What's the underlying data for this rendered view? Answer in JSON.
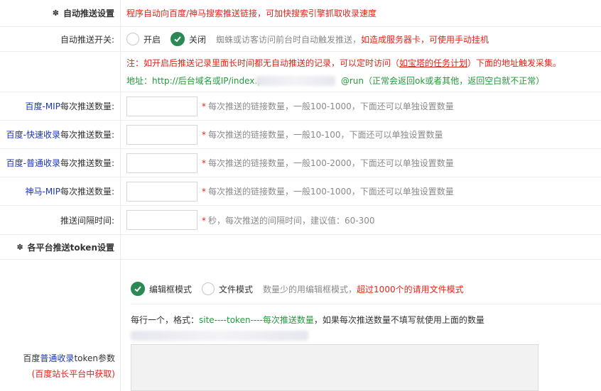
{
  "auto_push": {
    "section_title": "自动推送设置",
    "section_desc": "程序自动向百度/神马搜索推送链接，可加快搜索引擎抓取收录速度",
    "switch_label": "自动推送开关:",
    "switch_on": "开启",
    "switch_off": "关闭",
    "switch_hint": "蜘蛛或访客访问前台时自动触发推送，",
    "switch_hint_red": "如造成服务器卡，可使用手动挂机",
    "note_prefix": "注：如开启后推送记录里面长时间都无自动推送的记录，可以定时访问（",
    "note_link": "如宝塔的任务计划",
    "note_suffix": "）下面的地址触发采集。",
    "address_prefix": "地址：http://后台域名或IP/index.p",
    "address_suffix": "@run（正常会返回ok或者其他，返回空白就不正常）"
  },
  "fields": [
    {
      "label_blue": "百度-MIP",
      "label_rest": "每次推送数量:",
      "hint": "每次推送的链接数量，一般100-1000，下面还可以单独设置数量"
    },
    {
      "label_blue": "百度-快速收录",
      "label_rest": "每次推送数量:",
      "hint": "每次推送的链接数量，一般10-100，下面还可以单独设置数量"
    },
    {
      "label_blue": "百度-普通收录",
      "label_rest": "每次推送数量:",
      "hint": "每次推送的链接数量，一般100-2000，下面还可以单独设置数量"
    },
    {
      "label_blue": "神马-MIP",
      "label_rest": "每次推送数量:",
      "hint": "每次推送的链接数量，一般100-1000，下面还可以单独设置数量"
    },
    {
      "label_blue": "",
      "label_rest": "推送间隔时间:",
      "hint": "秒，每次推送的间隔时间，建议值：60-300"
    }
  ],
  "hint_star": "*",
  "token": {
    "section_title": "各平台推送token设置",
    "mode_editor": "编辑框模式",
    "mode_file": "文件模式",
    "mode_hint": "数量少的用编辑框模式，",
    "mode_hint_red": "超过1000个的请用文件模式",
    "format_prefix": "每行一个，格式：",
    "format_green": "site----token----",
    "format_blue": "每次推送数量",
    "format_suffix": "，如果每次推送数量不填写就使用上面的数量",
    "baidu_label_pre": "百度",
    "baidu_label_blue": "普通收录",
    "baidu_label_post": "token参数",
    "baidu_sub": "(百度站长平台中获取)"
  }
}
